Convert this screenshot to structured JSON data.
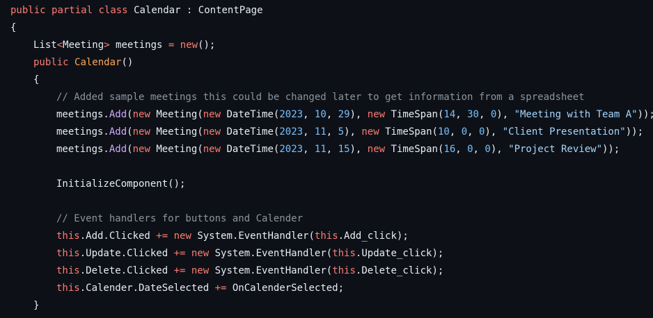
{
  "code": {
    "l1": {
      "a": "public",
      "b": "partial",
      "c": "class",
      "d": "Calendar : ContentPage"
    },
    "l2": {
      "a": "{"
    },
    "l3": {
      "a": "List",
      "b": "<",
      "c": "Meeting",
      "d": ">",
      "e": " meetings ",
      "f": "=",
      "g": " ",
      "h": "new",
      "i": "();"
    },
    "l4": {
      "a": "public",
      "b": "Calendar",
      "c": "()"
    },
    "l5": {
      "a": "{"
    },
    "l6": {
      "a": "// Added sample meetings this could be changed later to get information from a spreadsheet"
    },
    "l7": {
      "a": "meetings.",
      "b": "Add",
      "c": "(",
      "d": "new",
      "e": " Meeting(",
      "f": "new",
      "g": " DateTime(",
      "h": "2023",
      "i": ", ",
      "j": "10",
      "k": ", ",
      "l": "29",
      "m": "), ",
      "n": "new",
      "o": " TimeSpan(",
      "p": "14",
      "q": ", ",
      "r": "30",
      "s": ", ",
      "t": "0",
      "u": "), ",
      "v": "\"Meeting with Team A\"",
      "w": "));"
    },
    "l8": {
      "a": "meetings.",
      "b": "Add",
      "c": "(",
      "d": "new",
      "e": " Meeting(",
      "f": "new",
      "g": " DateTime(",
      "h": "2023",
      "i": ", ",
      "j": "11",
      "k": ", ",
      "l": "5",
      "m": "), ",
      "n": "new",
      "o": " TimeSpan(",
      "p": "10",
      "q": ", ",
      "r": "0",
      "s": ", ",
      "t": "0",
      "u": "), ",
      "v": "\"Client Presentation\"",
      "w": "));"
    },
    "l9": {
      "a": "meetings.",
      "b": "Add",
      "c": "(",
      "d": "new",
      "e": " Meeting(",
      "f": "new",
      "g": " DateTime(",
      "h": "2023",
      "i": ", ",
      "j": "11",
      "k": ", ",
      "l": "15",
      "m": "), ",
      "n": "new",
      "o": " TimeSpan(",
      "p": "16",
      "q": ", ",
      "r": "0",
      "s": ", ",
      "t": "0",
      "u": "), ",
      "v": "\"Project Review\"",
      "w": "));"
    },
    "l11": {
      "a": "InitializeComponent();"
    },
    "l13": {
      "a": "// Event handlers for buttons and Calender"
    },
    "l14": {
      "a": "this",
      "b": ".Add.Clicked ",
      "c": "+=",
      "d": " ",
      "e": "new",
      "f": " System.EventHandler(",
      "g": "this",
      "h": ".Add_click);"
    },
    "l15": {
      "a": "this",
      "b": ".Update.Clicked ",
      "c": "+=",
      "d": " ",
      "e": "new",
      "f": " System.EventHandler(",
      "g": "this",
      "h": ".Update_click);"
    },
    "l16": {
      "a": "this",
      "b": ".Delete.Clicked ",
      "c": "+=",
      "d": " ",
      "e": "new",
      "f": " System.EventHandler(",
      "g": "this",
      "h": ".Delete_click);"
    },
    "l17": {
      "a": "this",
      "b": ".Calender.DateSelected ",
      "c": "+=",
      "d": " OnCalenderSelected;"
    },
    "l18": {
      "a": "}"
    }
  },
  "colors": {
    "background": "#0d1117",
    "keyword": "#ff7b72",
    "function": "#d2a8ff",
    "number": "#79c0ff",
    "string": "#a5d6ff",
    "comment": "#8b949e",
    "text": "#e6edf3",
    "class_name": "#ffa657"
  }
}
